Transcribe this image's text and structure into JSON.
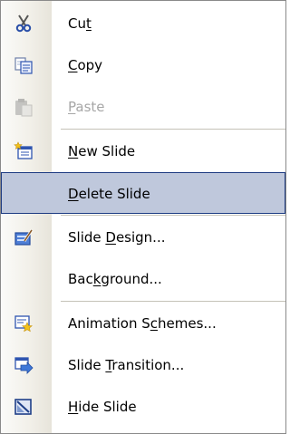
{
  "menu": {
    "items": [
      {
        "pre": "Cu",
        "key": "t",
        "post": "",
        "icon": "scissors-icon",
        "enabled": true
      },
      {
        "pre": "",
        "key": "C",
        "post": "opy",
        "icon": "copy-icon",
        "enabled": true
      },
      {
        "pre": "",
        "key": "P",
        "post": "aste",
        "icon": "clipboard-paste-icon",
        "enabled": false
      },
      {
        "pre": "",
        "key": "N",
        "post": "ew Slide",
        "icon": "new-slide-icon",
        "enabled": true
      },
      {
        "pre": "",
        "key": "D",
        "post": "elete Slide",
        "icon": "",
        "enabled": true,
        "highlighted": true
      },
      {
        "pre": "Slide ",
        "key": "D",
        "post": "esign...",
        "icon": "slide-design-icon",
        "enabled": true
      },
      {
        "pre": "Bac",
        "key": "k",
        "post": "ground...",
        "icon": "",
        "enabled": true
      },
      {
        "pre": "Animation S",
        "key": "c",
        "post": "hemes...",
        "icon": "animation-schemes-icon",
        "enabled": true
      },
      {
        "pre": "Slide ",
        "key": "T",
        "post": "ransition...",
        "icon": "slide-transition-icon",
        "enabled": true
      },
      {
        "pre": "",
        "key": "H",
        "post": "ide Slide",
        "icon": "hide-slide-icon",
        "enabled": true
      }
    ],
    "colors": {
      "highlight_fill": "#bfc8dc",
      "highlight_border": "#1d3b82",
      "disabled_text": "#a7a7a7"
    }
  }
}
